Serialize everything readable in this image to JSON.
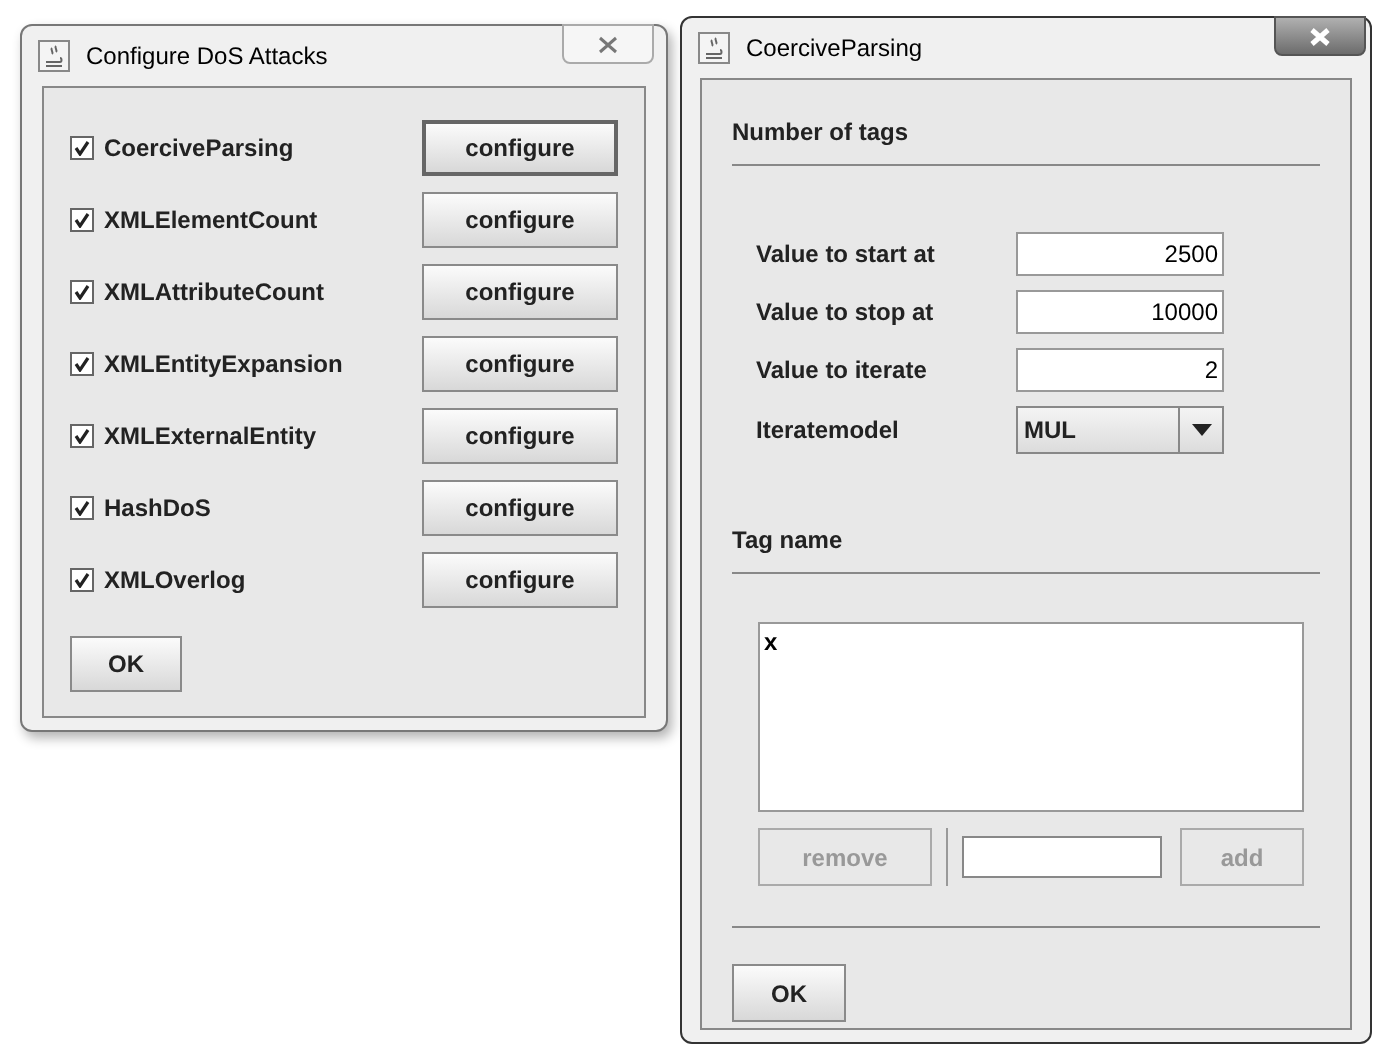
{
  "windows": [
    {
      "title": "Configure DoS Attacks",
      "active": false,
      "attacks": [
        {
          "label": "CoerciveParsing",
          "checked": true,
          "button": "configure",
          "selected": true
        },
        {
          "label": "XMLElementCount",
          "checked": true,
          "button": "configure",
          "selected": false
        },
        {
          "label": "XMLAttributeCount",
          "checked": true,
          "button": "configure",
          "selected": false
        },
        {
          "label": "XMLEntityExpansion",
          "checked": true,
          "button": "configure",
          "selected": false
        },
        {
          "label": "XMLExternalEntity",
          "checked": true,
          "button": "configure",
          "selected": false
        },
        {
          "label": "HashDoS",
          "checked": true,
          "button": "configure",
          "selected": false
        },
        {
          "label": "XMLOverlog",
          "checked": true,
          "button": "configure",
          "selected": false
        }
      ],
      "ok": "OK"
    },
    {
      "title": "CoerciveParsing",
      "active": true,
      "number_section": "Number of tags",
      "fields": [
        {
          "label": "Value to start at",
          "value": "2500"
        },
        {
          "label": "Value to stop at",
          "value": "10000"
        },
        {
          "label": "Value to iterate",
          "value": "2"
        }
      ],
      "iterate_model": {
        "label": "Iteratemodel",
        "value": "MUL"
      },
      "tag_section": "Tag name",
      "tags": [
        "x"
      ],
      "remove": {
        "label": "remove",
        "disabled": true
      },
      "add": {
        "label": "add",
        "disabled": true
      },
      "ok": "OK"
    }
  ]
}
